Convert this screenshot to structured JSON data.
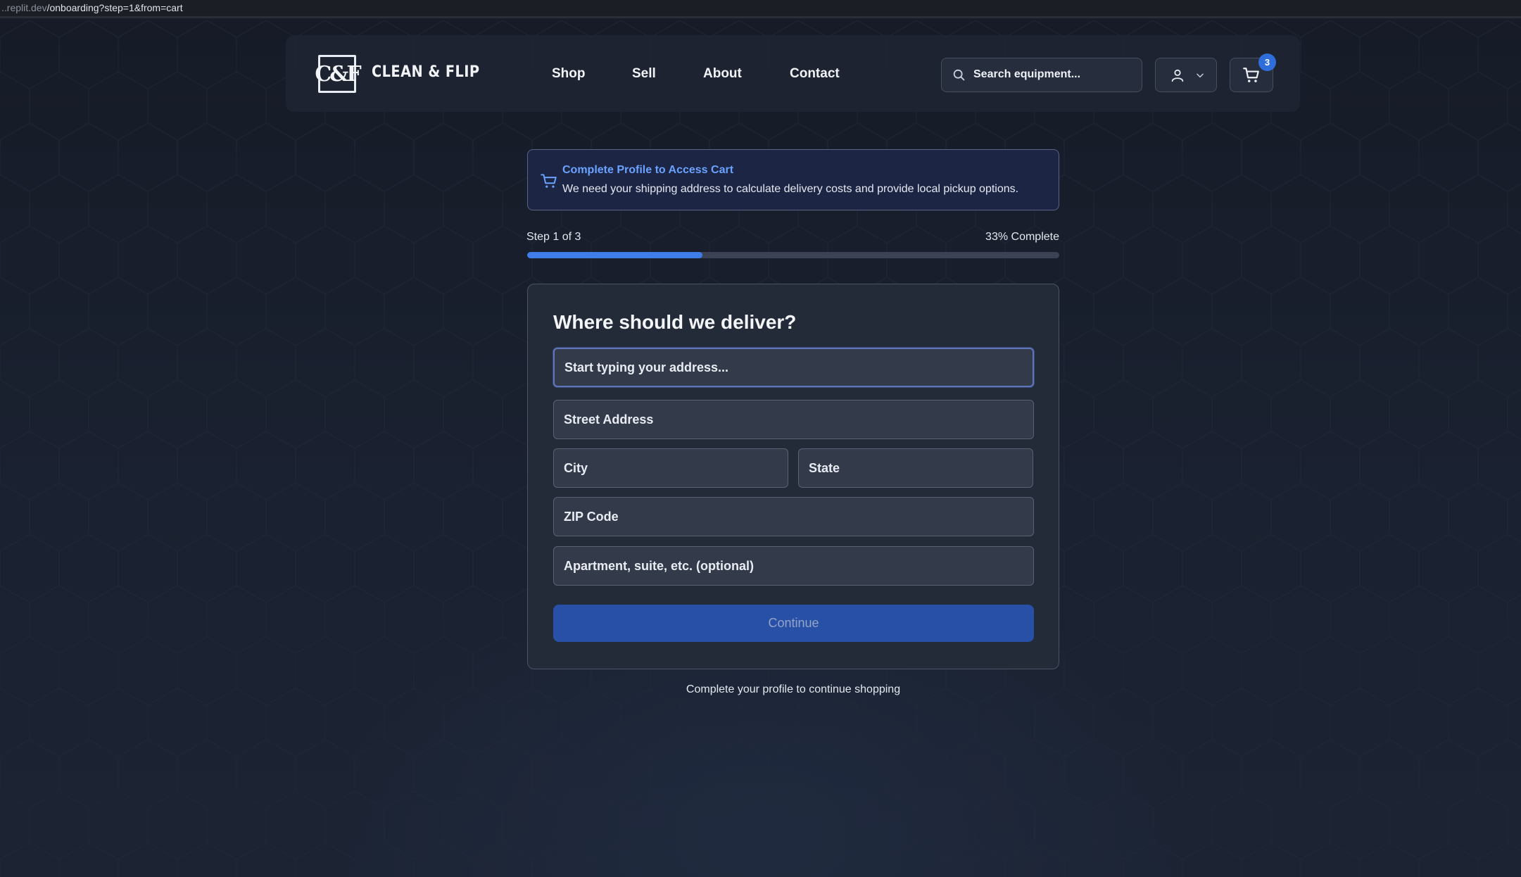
{
  "browser": {
    "url_prefix": "..replit.dev",
    "url_path": "/onboarding?step=1&from=cart"
  },
  "header": {
    "logo_text": "C&F",
    "brand": "CLEAN & FLIP",
    "nav": [
      "Shop",
      "Sell",
      "About",
      "Contact"
    ],
    "search_placeholder": "Search equipment...",
    "cart_count": "3",
    "icons": [
      "search-icon",
      "user-icon",
      "chevron-down-icon",
      "cart-icon"
    ]
  },
  "notice": {
    "title": "Complete Profile to Access Cart",
    "message": "We need your shipping address to calculate delivery costs and provide local pickup options.",
    "icon": "cart-icon"
  },
  "progress": {
    "step_label": "Step 1 of 3",
    "percent_label": "33% Complete",
    "fraction": 0.33
  },
  "form": {
    "heading": "Where should we deliver?",
    "address_search_placeholder": "Start typing your address...",
    "street_placeholder": "Street Address",
    "city_placeholder": "City",
    "state_placeholder": "State",
    "zip_placeholder": "ZIP Code",
    "apt_placeholder": "Apartment, suite, etc. (optional)",
    "continue_label": "Continue"
  },
  "footer_note": "Complete your profile to continue shopping",
  "colors": {
    "accent": "#3f7ee8",
    "notice_title": "#6aa3ff",
    "button": "#2750a6",
    "background": "#171c28"
  }
}
